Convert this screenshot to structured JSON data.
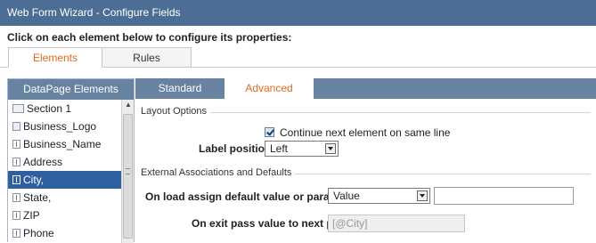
{
  "window": {
    "title": "Web Form Wizard - Configure Fields"
  },
  "instruction": "Click on each element below to configure its properties:",
  "top_tabs": [
    {
      "label": "Elements",
      "active": true
    },
    {
      "label": "Rules",
      "active": false
    }
  ],
  "left_panel": {
    "header": "DataPage Elements",
    "items": [
      {
        "label": "Section 1",
        "icon": "section-icon",
        "selected": false
      },
      {
        "label": "Business_Logo",
        "icon": "image-field-icon",
        "selected": false
      },
      {
        "label": "Business_Name",
        "icon": "text-field-icon",
        "selected": false
      },
      {
        "label": "Address",
        "icon": "text-field-icon",
        "selected": false
      },
      {
        "label": "City,",
        "icon": "text-field-icon",
        "selected": true
      },
      {
        "label": "State,",
        "icon": "text-field-icon",
        "selected": false
      },
      {
        "label": "ZIP",
        "icon": "text-field-icon",
        "selected": false
      },
      {
        "label": "Phone",
        "icon": "text-field-icon",
        "selected": false
      }
    ]
  },
  "sub_tabs": [
    {
      "label": "Standard",
      "active": false
    },
    {
      "label": "Advanced",
      "active": true
    }
  ],
  "layout_options": {
    "legend": "Layout Options",
    "continue_checkbox": {
      "label": "Continue next element on same line",
      "checked": true
    },
    "label_position": {
      "label": "Label position:",
      "value": "Left"
    }
  },
  "external": {
    "legend": "External Associations and Defaults",
    "on_load": {
      "label": "On load assign default value or parameter:",
      "value": "Value",
      "input_value": ""
    },
    "on_exit": {
      "label": "On exit pass value to next page:",
      "value": "[@City]"
    }
  },
  "colors": {
    "title_bar": "#4c6e94",
    "panel_header": "#6882a2",
    "selected_item": "#2e5f9f",
    "active_tab_text": "#e06a1a"
  }
}
